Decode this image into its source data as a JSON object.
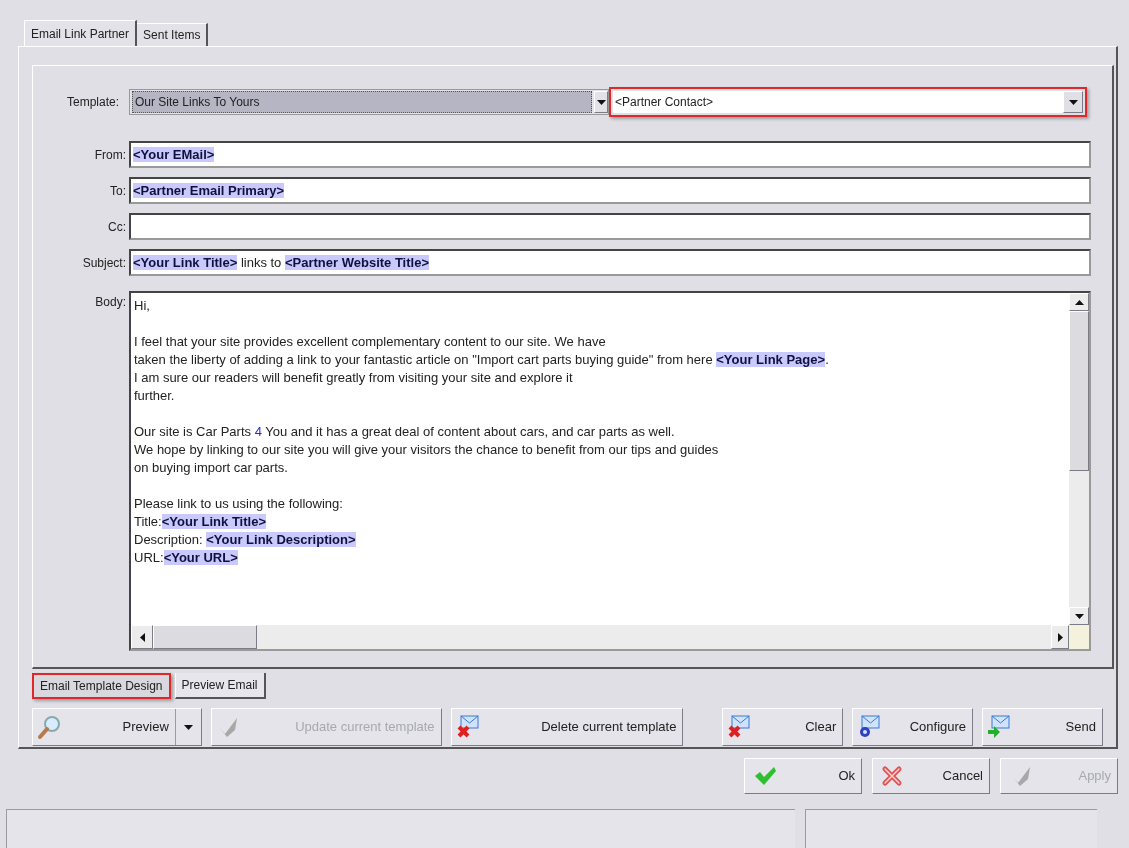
{
  "tabs": [
    {
      "label": "Email Link Partner",
      "selected": true
    },
    {
      "label": "Sent Items",
      "selected": false
    }
  ],
  "template": {
    "label": "Template:",
    "value": "Our Site Links To Yours"
  },
  "contact": {
    "value": "<Partner Contact>",
    "highlighted": true
  },
  "fields": [
    {
      "label": "From:",
      "segments": [
        {
          "kind": "placeholder",
          "text": "<Your EMail>"
        }
      ]
    },
    {
      "label": "To:",
      "segments": [
        {
          "kind": "placeholder",
          "text": "<Partner Email Primary>"
        }
      ]
    },
    {
      "label": "Cc:"
    },
    {
      "label": "Subject:",
      "segments": [
        {
          "kind": "placeholder",
          "text": "<Your Link Title>"
        },
        {
          "kind": "plain",
          "text": " links to "
        },
        {
          "kind": "placeholder",
          "text": "<Partner Website Title>"
        }
      ]
    }
  ],
  "body": {
    "label": "Body:",
    "paragraphs": [
      [
        [
          {
            "kind": "plain",
            "text": "Hi,"
          }
        ]
      ],
      [
        [
          {
            "kind": "plain",
            "text": "I feel that your site provides excellent complementary content to our site. We have"
          }
        ],
        [
          {
            "kind": "plain",
            "text": "taken the liberty of adding a link to your fantastic article on \"Import cart parts buying guide\" from here "
          },
          {
            "kind": "placeholder",
            "text": "<Your Link Page>"
          },
          {
            "kind": "plain",
            "text": "."
          }
        ],
        [
          {
            "kind": "plain",
            "text": "I am sure our readers will benefit greatly from visiting your site and explore it"
          }
        ],
        [
          {
            "kind": "plain",
            "text": "further."
          }
        ]
      ],
      [
        [
          {
            "kind": "plain",
            "text": "Our site is Car Parts "
          },
          {
            "kind": "number",
            "text": "4"
          },
          {
            "kind": "plain",
            "text": " You and it has a great deal of content about cars, and car parts as well."
          }
        ],
        [
          {
            "kind": "plain",
            "text": "We hope by linking to our site you will give your visitors the chance to benefit from our tips and guides"
          }
        ],
        [
          {
            "kind": "plain",
            "text": "on buying import car parts."
          }
        ]
      ],
      [
        [
          {
            "kind": "plain",
            "text": "Please link to us using the following:"
          }
        ],
        [
          {
            "kind": "plain",
            "text": "Title:"
          },
          {
            "kind": "placeholder",
            "text": "<Your Link Title>"
          }
        ],
        [
          {
            "kind": "plain",
            "text": "Description: "
          },
          {
            "kind": "placeholder",
            "text": "<Your Link Description>"
          }
        ],
        [
          {
            "kind": "plain",
            "text": "URL:"
          },
          {
            "kind": "placeholder",
            "text": "<Your URL>"
          }
        ]
      ]
    ]
  },
  "design_tabs": [
    {
      "label": "Email Template Design",
      "selected": true,
      "highlighted": true
    },
    {
      "label": "Preview Email",
      "selected": false,
      "highlighted": false
    }
  ],
  "toolbar_buttons": [
    {
      "label": "Preview",
      "disabled": false,
      "has_menu": true
    },
    {
      "label": "Update current template",
      "disabled": true,
      "has_menu": false
    },
    {
      "label": "Delete current template",
      "disabled": false,
      "has_menu": false
    },
    {
      "label": "Clear",
      "disabled": false,
      "has_menu": false
    },
    {
      "label": "Configure",
      "disabled": false,
      "has_menu": false
    },
    {
      "label": "Send",
      "disabled": false,
      "has_menu": false
    }
  ],
  "dialog_buttons": [
    {
      "label": "Ok",
      "disabled": false
    },
    {
      "label": "Cancel",
      "disabled": false
    },
    {
      "label": "Apply",
      "disabled": true
    }
  ]
}
